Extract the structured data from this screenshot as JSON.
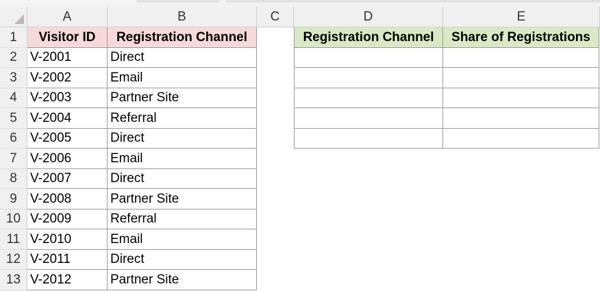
{
  "columns": [
    "A",
    "B",
    "C",
    "D",
    "E"
  ],
  "rows": [
    "1",
    "2",
    "3",
    "4",
    "5",
    "6",
    "7",
    "8",
    "9",
    "10",
    "11",
    "12",
    "13"
  ],
  "table1": {
    "header_visitor": "Visitor ID",
    "header_channel": "Registration Channel",
    "visitor_ids": [
      "V-2001",
      "V-2002",
      "V-2003",
      "V-2004",
      "V-2005",
      "V-2006",
      "V-2007",
      "V-2008",
      "V-2009",
      "V-2010",
      "V-2011",
      "V-2012"
    ],
    "channels": [
      "Direct",
      "Email",
      "Partner Site",
      "Referral",
      "Direct",
      "Email",
      "Direct",
      "Partner Site",
      "Referral",
      "Email",
      "Direct",
      "Partner Site"
    ]
  },
  "table2": {
    "header_channel": "Registration Channel",
    "header_share": "Share of Registrations"
  },
  "colors": {
    "header_pink": "#f8d9d9",
    "header_green": "#d9e9c5"
  }
}
